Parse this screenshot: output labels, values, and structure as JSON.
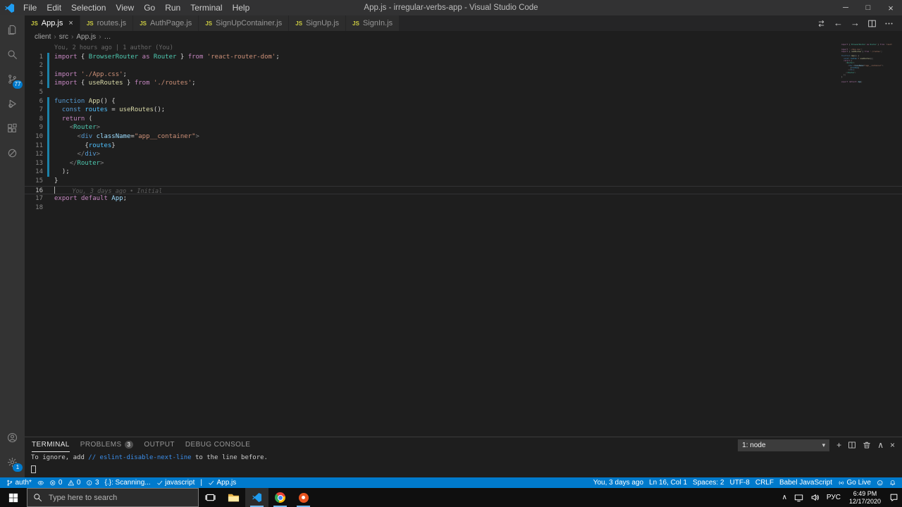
{
  "colors": {
    "titlebar_bg": "#323233",
    "activitybar_bg": "#333333",
    "editor_bg": "#1E1E1E",
    "tabbar_bg": "#252526",
    "tab_inactive_bg": "#2D2D2D",
    "statusbar_bg": "#007ACC",
    "badge_bg": "#007ACC",
    "taskbar_bg": "#0F0F0F",
    "accent_keyword": "#C586C0",
    "accent_keyword2": "#569CD6",
    "accent_type": "#4EC9B0",
    "accent_function": "#DCDCAA",
    "accent_variable": "#9CDCFE",
    "accent_string": "#CE9178",
    "git_modified": "#1B81A8",
    "terminal_link": "#3B8EEA"
  },
  "window": {
    "title": "App.js - irregular-verbs-app - Visual Studio Code",
    "menus": [
      "File",
      "Edit",
      "Selection",
      "View",
      "Go",
      "Run",
      "Terminal",
      "Help"
    ]
  },
  "activity_bar": {
    "top": [
      {
        "name": "explorer",
        "icon": "files"
      },
      {
        "name": "search",
        "icon": "search"
      },
      {
        "name": "source-control",
        "icon": "branch",
        "badge": "77"
      },
      {
        "name": "run-and-debug",
        "icon": "debug"
      },
      {
        "name": "extensions",
        "icon": "extensions"
      },
      {
        "name": "extension-view",
        "icon": "circle-slash"
      }
    ],
    "bottom": [
      {
        "name": "accounts",
        "icon": "account"
      },
      {
        "name": "manage-settings",
        "icon": "gear",
        "badge": "1"
      }
    ]
  },
  "editor_tabs": [
    {
      "label": "App.js",
      "active": true
    },
    {
      "label": "routes.js"
    },
    {
      "label": "AuthPage.js"
    },
    {
      "label": "SignUpContainer.js"
    },
    {
      "label": "SignUp.js"
    },
    {
      "label": "SignIn.js"
    }
  ],
  "editor_actions": [
    {
      "name": "open-changes-icon",
      "glyph": "compare"
    },
    {
      "name": "back-icon",
      "glyph": "back"
    },
    {
      "name": "forward-icon",
      "glyph": "forward"
    },
    {
      "name": "split-editor-icon",
      "glyph": "split"
    },
    {
      "name": "more-actions-icon",
      "glyph": "more"
    }
  ],
  "breadcrumbs": [
    "client",
    "src",
    "App.js",
    "…"
  ],
  "editor": {
    "codelens": "You, 2 hours ago | 1 author (You)",
    "current_line": 16,
    "inline_blame": "You, 3 days ago • Initial",
    "modified_lines": [
      1,
      2,
      3,
      4,
      6,
      7,
      8,
      9,
      10,
      11,
      12,
      13,
      14
    ],
    "lines": [
      {
        "tokens": [
          [
            "import",
            "kw"
          ],
          [
            " { ",
            "pl"
          ],
          [
            "BrowserRouter",
            "type"
          ],
          [
            " ",
            "pl"
          ],
          [
            "as",
            "kw"
          ],
          [
            " ",
            "pl"
          ],
          [
            "Router",
            "type"
          ],
          [
            " } ",
            "pl"
          ],
          [
            "from",
            "kw"
          ],
          [
            " ",
            "pl"
          ],
          [
            "'react-router-dom'",
            "str"
          ],
          [
            ";",
            "pl"
          ]
        ]
      },
      {
        "tokens": []
      },
      {
        "tokens": [
          [
            "import",
            "kw"
          ],
          [
            " ",
            "pl"
          ],
          [
            "'./App.css'",
            "str"
          ],
          [
            ";",
            "pl"
          ]
        ]
      },
      {
        "tokens": [
          [
            "import",
            "kw"
          ],
          [
            " { ",
            "pl"
          ],
          [
            "useRoutes",
            "fn"
          ],
          [
            " } ",
            "pl"
          ],
          [
            "from",
            "kw"
          ],
          [
            " ",
            "pl"
          ],
          [
            "'./routes'",
            "str"
          ],
          [
            ";",
            "pl"
          ]
        ]
      },
      {
        "tokens": []
      },
      {
        "tokens": [
          [
            "function",
            "kw2"
          ],
          [
            " ",
            "pl"
          ],
          [
            "App",
            "fn"
          ],
          [
            "() {",
            "pl"
          ]
        ]
      },
      {
        "tokens": [
          [
            "  ",
            "pl"
          ],
          [
            "const",
            "kw2"
          ],
          [
            " ",
            "pl"
          ],
          [
            "routes",
            "cv"
          ],
          [
            " = ",
            "pl"
          ],
          [
            "useRoutes",
            "fn"
          ],
          [
            "();",
            "pl"
          ]
        ]
      },
      {
        "tokens": [
          [
            "  ",
            "pl"
          ],
          [
            "return",
            "kw"
          ],
          [
            " (",
            "pl"
          ]
        ]
      },
      {
        "tokens": [
          [
            "    ",
            "pl"
          ],
          [
            "<",
            "br"
          ],
          [
            "Router",
            "type"
          ],
          [
            ">",
            "br"
          ]
        ]
      },
      {
        "tokens": [
          [
            "      ",
            "pl"
          ],
          [
            "<",
            "br"
          ],
          [
            "div",
            "kw2"
          ],
          [
            " ",
            "pl"
          ],
          [
            "className",
            "var"
          ],
          [
            "=",
            "pl"
          ],
          [
            "\"app__container\"",
            "str"
          ],
          [
            ">",
            "br"
          ]
        ]
      },
      {
        "tokens": [
          [
            "        {",
            "pl"
          ],
          [
            "routes",
            "cv"
          ],
          [
            "}",
            "pl"
          ]
        ]
      },
      {
        "tokens": [
          [
            "      ",
            "pl"
          ],
          [
            "</",
            "br"
          ],
          [
            "div",
            "kw2"
          ],
          [
            ">",
            "br"
          ]
        ]
      },
      {
        "tokens": [
          [
            "    ",
            "pl"
          ],
          [
            "</",
            "br"
          ],
          [
            "Router",
            "type"
          ],
          [
            ">",
            "br"
          ]
        ]
      },
      {
        "tokens": [
          [
            "  );",
            "pl"
          ]
        ]
      },
      {
        "tokens": [
          [
            "}",
            "pl"
          ]
        ]
      },
      {
        "tokens": []
      },
      {
        "tokens": [
          [
            "export",
            "kw"
          ],
          [
            " ",
            "pl"
          ],
          [
            "default",
            "kw"
          ],
          [
            " ",
            "pl"
          ],
          [
            "App",
            "var"
          ],
          [
            ";",
            "pl"
          ]
        ]
      },
      {
        "tokens": []
      }
    ]
  },
  "terminal": {
    "tabs": [
      {
        "label": "TERMINAL",
        "active": true
      },
      {
        "label": "PROBLEMS",
        "badge": "3"
      },
      {
        "label": "OUTPUT"
      },
      {
        "label": "DEBUG CONSOLE"
      }
    ],
    "shell_selector": "1: node",
    "actions": [
      {
        "name": "new-terminal-icon",
        "glyph": "plus"
      },
      {
        "name": "split-terminal-icon",
        "glyph": "split"
      },
      {
        "name": "kill-terminal-icon",
        "glyph": "trash"
      },
      {
        "name": "maximize-panel-icon",
        "glyph": "chevron-up"
      },
      {
        "name": "close-panel-icon",
        "glyph": "close"
      }
    ],
    "output": [
      [
        "To ignore, add ",
        "plain"
      ],
      [
        "// eslint-disable-next-line",
        "link"
      ],
      [
        " to the line before.",
        "plain"
      ]
    ]
  },
  "status_bar": {
    "left": [
      {
        "name": "git-branch",
        "icon": "branch",
        "label": "auth*"
      },
      {
        "name": "gitlens-blame-toggle",
        "icon": "eye",
        "label": ""
      },
      {
        "name": "errors",
        "icon": "error",
        "label": "0"
      },
      {
        "name": "warnings",
        "icon": "warning",
        "label": "0"
      },
      {
        "name": "infos",
        "icon": "info",
        "label": "3"
      },
      {
        "name": "spell-checker",
        "label": "{.}: Scanning..."
      },
      {
        "name": "eslint-status",
        "icon": "check",
        "label": "javascript"
      },
      {
        "name": "separator",
        "label": "|"
      },
      {
        "name": "prettier-status",
        "icon": "check",
        "label": "App.js"
      }
    ],
    "right": [
      {
        "name": "blame-info",
        "label": "You, 3 days ago"
      },
      {
        "name": "cursor-position",
        "label": "Ln 16, Col 1"
      },
      {
        "name": "indentation",
        "label": "Spaces: 2"
      },
      {
        "name": "encoding",
        "label": "UTF-8"
      },
      {
        "name": "eol-sequence",
        "label": "CRLF"
      },
      {
        "name": "language-mode",
        "label": "Babel JavaScript"
      },
      {
        "name": "go-live",
        "icon": "broadcast",
        "label": "Go Live"
      },
      {
        "name": "feedback",
        "icon": "smiley",
        "label": ""
      },
      {
        "name": "notifications",
        "icon": "bell",
        "label": ""
      }
    ]
  },
  "taskbar": {
    "search_placeholder": "Type here to search",
    "apps": [
      {
        "name": "task-view",
        "icon": "taskview"
      },
      {
        "name": "file-explorer",
        "icon": "folder"
      },
      {
        "name": "vscode",
        "icon": "vscode-logo",
        "running": true,
        "focused": true
      },
      {
        "name": "chrome",
        "icon": "chrome",
        "running": true
      },
      {
        "name": "screen-recorder",
        "icon": "orange",
        "running": true
      }
    ],
    "tray": {
      "language": "РУС",
      "time": "6:49 PM",
      "date": "12/17/2020"
    }
  }
}
